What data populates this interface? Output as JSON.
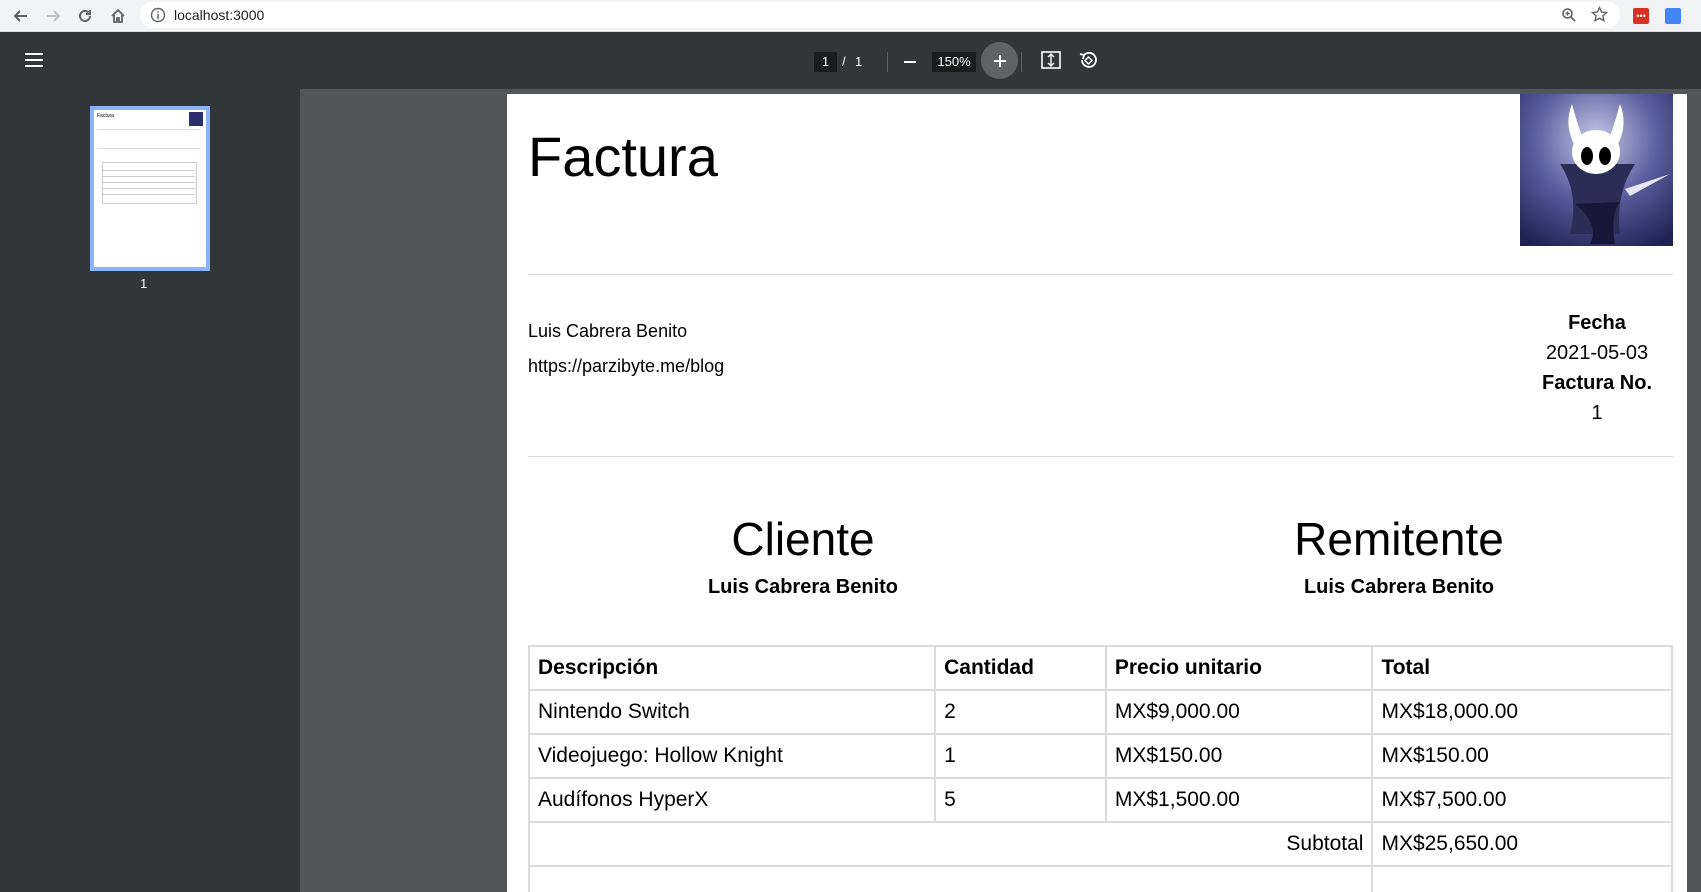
{
  "browser": {
    "url": "localhost:3000"
  },
  "pdf_toolbar": {
    "current_page": "1",
    "page_separator": "/",
    "total_pages": "1",
    "zoom": "150%"
  },
  "sidebar": {
    "thumbnail_page_number": "1"
  },
  "invoice": {
    "title": "Factura",
    "issuer_name": "Luis Cabrera Benito",
    "issuer_url": "https://parzibyte.me/blog",
    "date_label": "Fecha",
    "date_value": "2021-05-03",
    "number_label": "Factura No.",
    "number_value": "1",
    "client_heading": "Cliente",
    "client_name": "Luis Cabrera Benito",
    "sender_heading": "Remitente",
    "sender_name": "Luis Cabrera Benito",
    "table": {
      "headers": [
        "Descripción",
        "Cantidad",
        "Precio unitario",
        "Total"
      ],
      "rows": [
        [
          "Nintendo Switch",
          "2",
          "MX$9,000.00",
          "MX$18,000.00"
        ],
        [
          "Videojuego: Hollow Knight",
          "1",
          "MX$150.00",
          "MX$150.00"
        ],
        [
          "Audífonos HyperX",
          "5",
          "MX$1,500.00",
          "MX$7,500.00"
        ]
      ],
      "subtotal_label": "Subtotal",
      "subtotal_value": "MX$25,650.00"
    }
  }
}
